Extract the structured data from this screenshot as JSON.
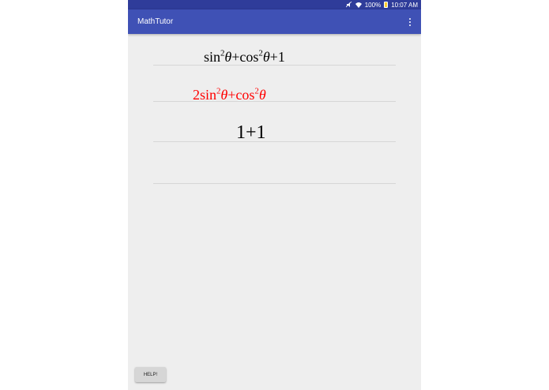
{
  "status_bar": {
    "battery_text": "100%",
    "time": "10:07 AM",
    "icons": [
      "mute-icon",
      "wifi-icon",
      "battery-icon"
    ]
  },
  "app_bar": {
    "title": "MathTutor",
    "menu_icon": "overflow-menu-icon"
  },
  "expressions": [
    {
      "parts": [
        "sin",
        "2",
        "θ",
        "+cos",
        "2",
        "θ",
        "+1"
      ],
      "color": "#000000"
    },
    {
      "parts": [
        "2sin",
        "2",
        "θ",
        "+cos",
        "2",
        "θ"
      ],
      "color": "#ff0000"
    },
    {
      "parts": [
        "1+1"
      ],
      "color": "#000000"
    }
  ],
  "help_button": {
    "label": "HELP!"
  },
  "colors": {
    "status_bar": "#2f3c9a",
    "app_bar": "#3f51b5",
    "background": "#eeeeee",
    "highlight_expression": "#ff0000"
  }
}
